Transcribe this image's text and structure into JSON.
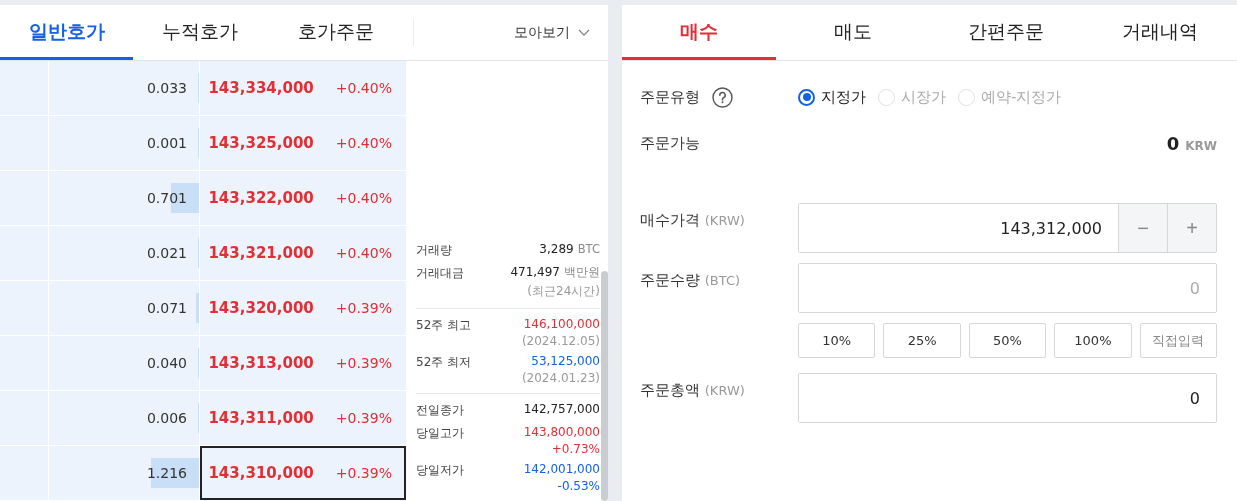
{
  "orderbook": {
    "tabs": [
      {
        "label": "일반호가",
        "selected": true
      },
      {
        "label": "누적호가",
        "selected": false
      },
      {
        "label": "호가주문",
        "selected": false
      }
    ],
    "view_menu": {
      "label": "모아보기"
    },
    "rows": [
      {
        "quantity": "0.033",
        "level": 0.01,
        "price": "143,334,000",
        "change": "+0.40%",
        "selected": false
      },
      {
        "quantity": "0.001",
        "level": 0.005,
        "price": "143,325,000",
        "change": "+0.40%",
        "selected": false
      },
      {
        "quantity": "0.701",
        "level": 0.19,
        "price": "143,322,000",
        "change": "+0.40%",
        "selected": false
      },
      {
        "quantity": "0.021",
        "level": 0.01,
        "price": "143,321,000",
        "change": "+0.40%",
        "selected": false
      },
      {
        "quantity": "0.071",
        "level": 0.02,
        "price": "143,320,000",
        "change": "+0.39%",
        "selected": false
      },
      {
        "quantity": "0.040",
        "level": 0.01,
        "price": "143,313,000",
        "change": "+0.39%",
        "selected": false
      },
      {
        "quantity": "0.006",
        "level": 0.005,
        "price": "143,311,000",
        "change": "+0.39%",
        "selected": false
      },
      {
        "quantity": "1.216",
        "level": 0.32,
        "price": "143,310,000",
        "change": "+0.39%",
        "selected": true
      }
    ],
    "stats": [
      [
        {
          "label": "거래량",
          "value": "3,289",
          "unit": "BTC",
          "color": "#222222"
        },
        {
          "label": "거래대금",
          "value": "471,497",
          "unit": "백만원",
          "sub": {
            "text": "(최근24시간)",
            "color": "#999999"
          },
          "color": "#222222"
        }
      ],
      [
        {
          "label": "52주 최고",
          "value": "146,100,000",
          "sub": {
            "text": "(2024.12.05)",
            "color": "#999999"
          },
          "color": "#e12f36"
        },
        {
          "label": "52주 최저",
          "value": "53,125,000",
          "sub": {
            "text": "(2024.01.23)",
            "color": "#999999"
          },
          "color": "#1561e5"
        }
      ],
      [
        {
          "label": "전일종가",
          "value": "142,757,000",
          "color": "#222222"
        },
        {
          "label": "당일고가",
          "value": "143,800,000",
          "sub": {
            "text": "+0.73%",
            "color": "#e12f36"
          },
          "color": "#e12f36"
        },
        {
          "label": "당일저가",
          "value": "142,001,000",
          "sub": {
            "text": "-0.53%",
            "color": "#1561e5"
          },
          "color": "#1561e5"
        }
      ]
    ]
  },
  "order": {
    "tabs": [
      {
        "label": "매수",
        "selected": true
      },
      {
        "label": "매도",
        "selected": false
      },
      {
        "label": "간편주문",
        "selected": false
      },
      {
        "label": "거래내역",
        "selected": false
      }
    ],
    "order_type": {
      "label": "주문유형",
      "options": [
        {
          "label": "지정가",
          "selected": true,
          "disabled": false
        },
        {
          "label": "시장가",
          "selected": false,
          "disabled": true
        },
        {
          "label": "예약-지정가",
          "selected": false,
          "disabled": true
        }
      ]
    },
    "available": {
      "label": "주문가능",
      "value": "0",
      "unit": "KRW"
    },
    "price": {
      "label": "매수가격",
      "unit": "(KRW)",
      "value": "143,312,000",
      "minus": "−",
      "plus": "+"
    },
    "quantity": {
      "label": "주문수량",
      "unit": "(BTC)",
      "placeholder": "0"
    },
    "percent_buttons": [
      {
        "label": "10%",
        "kind": "preset"
      },
      {
        "label": "25%",
        "kind": "preset"
      },
      {
        "label": "50%",
        "kind": "preset"
      },
      {
        "label": "100%",
        "kind": "preset"
      },
      {
        "label": "직접입력",
        "kind": "manual"
      }
    ],
    "total": {
      "label": "주문총액",
      "unit": "(KRW)",
      "value": "0"
    }
  }
}
